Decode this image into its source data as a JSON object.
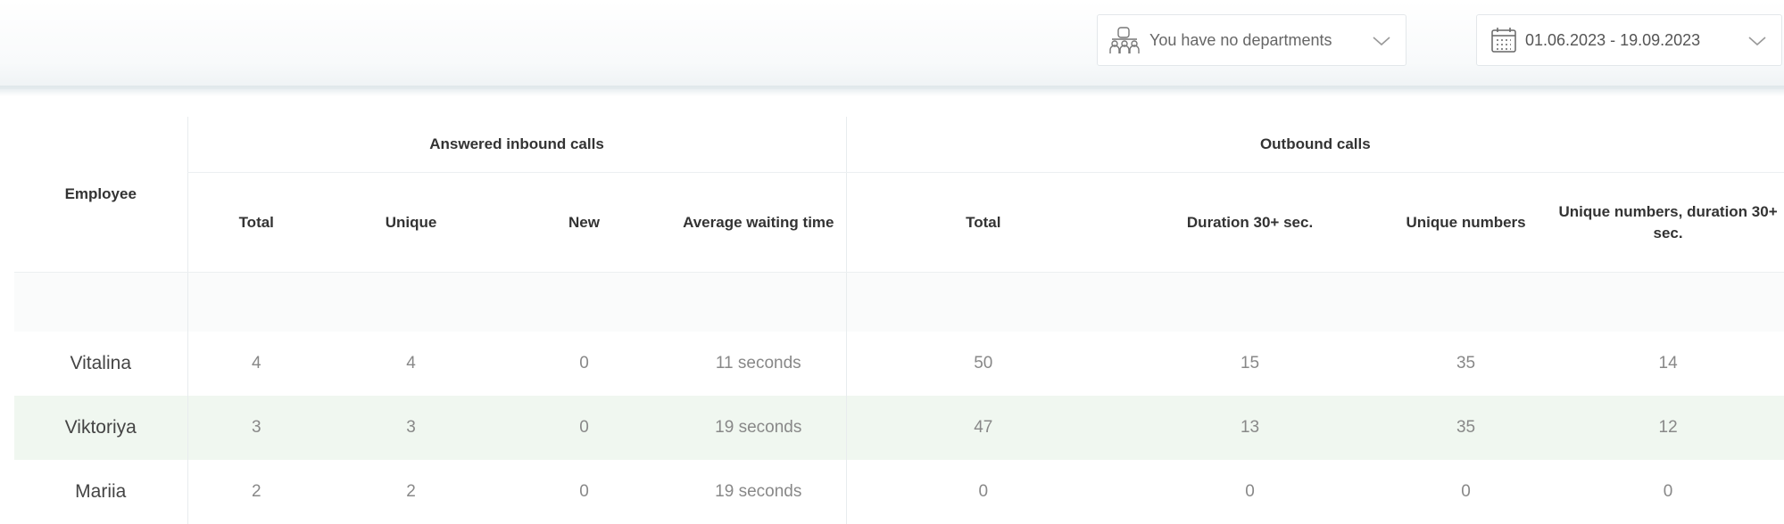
{
  "filters": {
    "department": {
      "label": "You have no departments",
      "icon": "departments-icon"
    },
    "date_range": {
      "label": "01.06.2023  -  19.09.2023",
      "icon": "calendar-icon"
    }
  },
  "table": {
    "employee_header": "Employee",
    "groups": [
      "Answered inbound calls",
      "Outbound calls"
    ],
    "inbound_columns": [
      "Total",
      "Unique",
      "New",
      "Average waiting time"
    ],
    "outbound_columns": [
      "Total",
      "Duration 30+ sec.",
      "Unique numbers",
      "Unique numbers, duration 30+ sec."
    ],
    "rows": [
      {
        "employee": "Vitalina",
        "in_total": "4",
        "in_unique": "4",
        "in_new": "0",
        "avg_wait": "11 seconds",
        "out_total": "50",
        "out_30": "15",
        "out_unique": "35",
        "out_unique_30": "14"
      },
      {
        "employee": "Viktoriya",
        "in_total": "3",
        "in_unique": "3",
        "in_new": "0",
        "avg_wait": "19 seconds",
        "out_total": "47",
        "out_30": "13",
        "out_unique": "35",
        "out_unique_30": "12"
      },
      {
        "employee": "Mariia",
        "in_total": "2",
        "in_unique": "2",
        "in_new": "0",
        "avg_wait": "19 seconds",
        "out_total": "0",
        "out_30": "0",
        "out_unique": "0",
        "out_unique_30": "0"
      }
    ]
  },
  "colors": {
    "highlight_row": "#f0f7f0",
    "border": "#e8ecee"
  }
}
